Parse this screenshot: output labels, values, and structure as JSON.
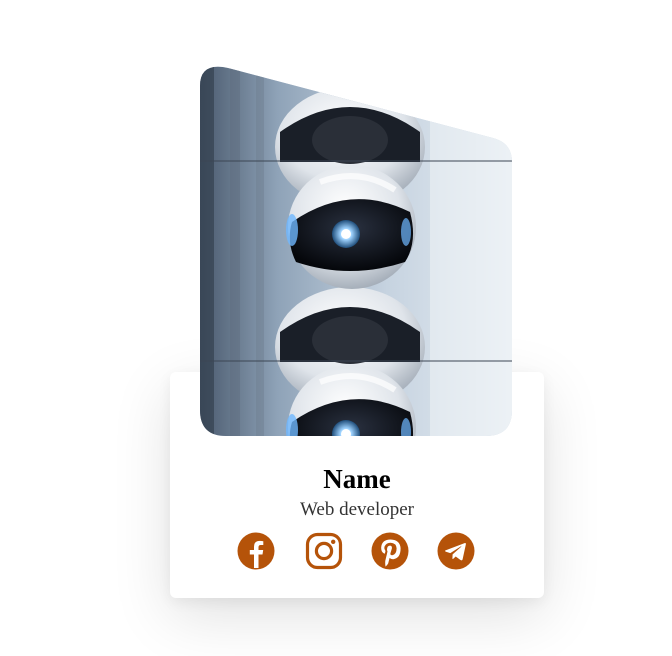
{
  "profile": {
    "name": "Name",
    "role": "Web developer"
  },
  "socials": [
    {
      "icon": "facebook-icon"
    },
    {
      "icon": "instagram-icon"
    },
    {
      "icon": "pinterest-icon"
    },
    {
      "icon": "telegram-icon"
    }
  ],
  "colors": {
    "accent": "#b55309",
    "card_background": "#ffffff",
    "name_text": "#000000",
    "role_text": "#333333"
  }
}
